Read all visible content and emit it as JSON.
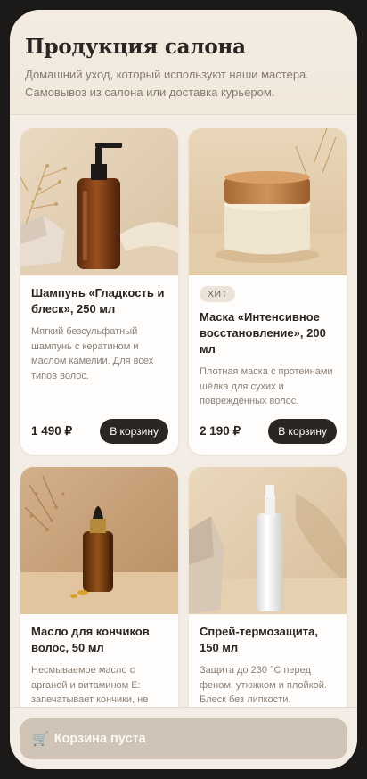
{
  "header": {
    "title": "Продукция салона",
    "subtitle": "Домашний уход, который используют наши мастера. Самовывоз из салона или доставка курьером."
  },
  "products": [
    {
      "name": "Шампунь «Гладкость и блеск», 250 мл",
      "description": "Мягкий безсульфатный шампунь с кератином и маслом камелии. Для всех типов волос.",
      "price": "1 490 ₽",
      "button": "В корзину"
    },
    {
      "badge": "ХИТ",
      "name": "Маска «Интенсивное восстановление», 200 мл",
      "description": "Плотная маска с протеинами шёлка для сухих и повреждённых волос.",
      "price": "2 190 ₽",
      "button": "В корзину"
    },
    {
      "name": "Масло для кончиков волос, 50 мл",
      "description": "Несмываемое масло с арганой и витамином Е: запечатывает кончики, не"
    },
    {
      "name": "Спрей-термозащита, 150 мл",
      "description": "Защита до 230 °С перед феном, утюжком и плойкой. Блеск без липкости."
    }
  ],
  "cart": {
    "icon": "cart-icon",
    "glyph": "🛒",
    "label": "Корзина пуста"
  },
  "colors": {
    "accent": "#2c2622",
    "background": "#f3ede5",
    "cart_disabled": "#cfc4b5"
  }
}
